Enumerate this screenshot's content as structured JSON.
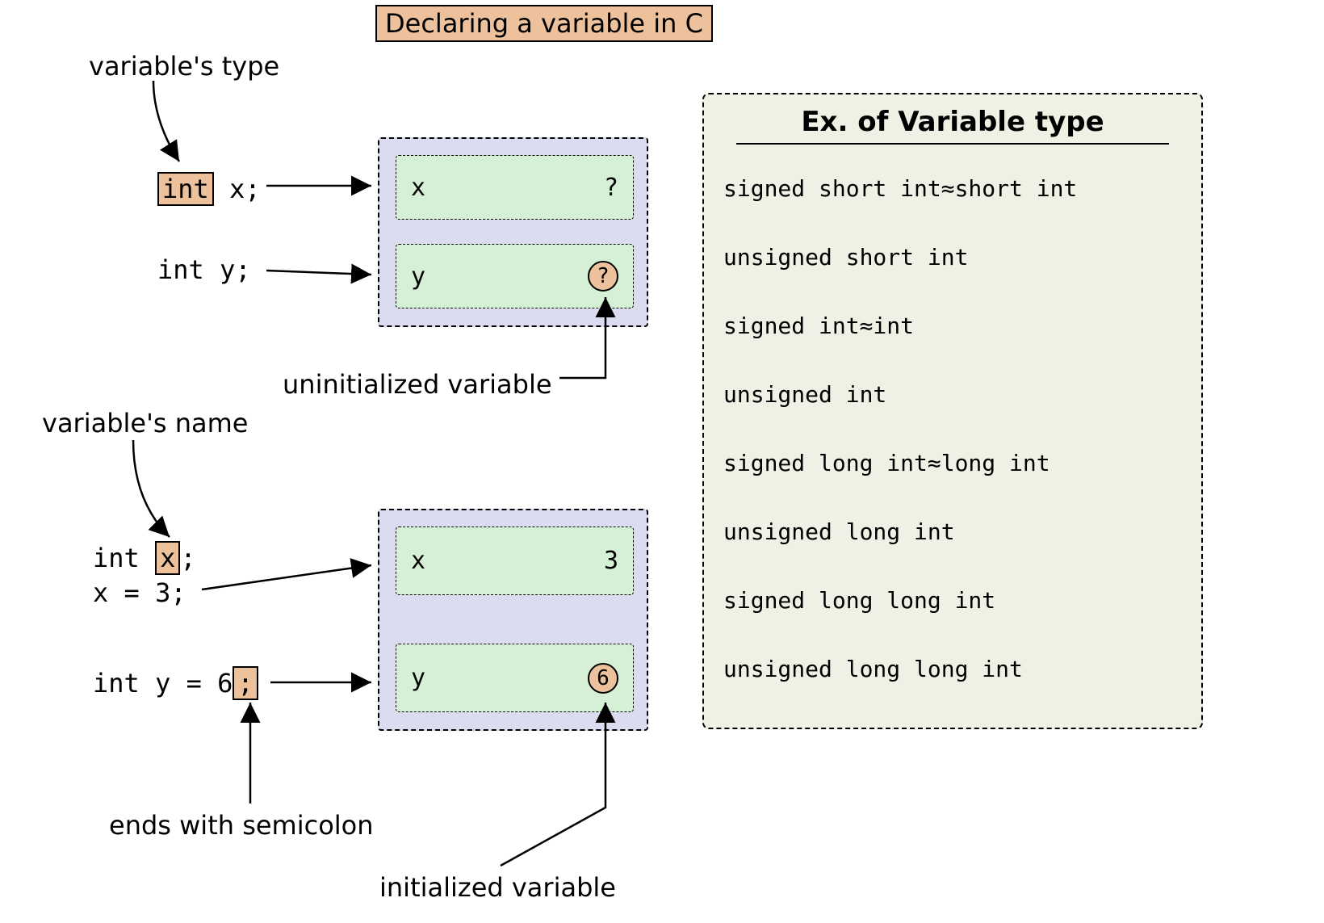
{
  "title": "Declaring a variable in C",
  "labels": {
    "vartype": "variable's type",
    "varname": "variable's name",
    "uninit": "uninitialized variable",
    "init": "initialized variable",
    "semicolon": "ends with semicolon"
  },
  "code": {
    "block1_l1_type": "int",
    "block1_l1_rest": " x;",
    "block1_l2": "int y;",
    "block2_l1_pre": "int ",
    "block2_l1_var": "x",
    "block2_l1_post": ";",
    "block2_l2": "x = 3;",
    "block2_l3_pre": "int y = 6",
    "block2_l3_semi": ";"
  },
  "memory": {
    "block1": {
      "c1_name": "x",
      "c1_val": "?",
      "c2_name": "y",
      "c2_val": "?"
    },
    "block2": {
      "c1_name": "x",
      "c1_val": "3",
      "c2_name": "y",
      "c2_val": "6"
    }
  },
  "types_panel": {
    "title": "Ex. of Variable type",
    "approx": "≈",
    "items": [
      {
        "a": "signed short int",
        "b": "short int"
      },
      {
        "a": "unsigned short int",
        "b": ""
      },
      {
        "a": "signed int",
        "b": "int"
      },
      {
        "a": "unsigned int",
        "b": ""
      },
      {
        "a": "signed long int",
        "b": "long int"
      },
      {
        "a": "unsigned long int",
        "b": ""
      },
      {
        "a": "signed long long int",
        "b": ""
      },
      {
        "a": "unsigned long long int",
        "b": ""
      }
    ]
  }
}
